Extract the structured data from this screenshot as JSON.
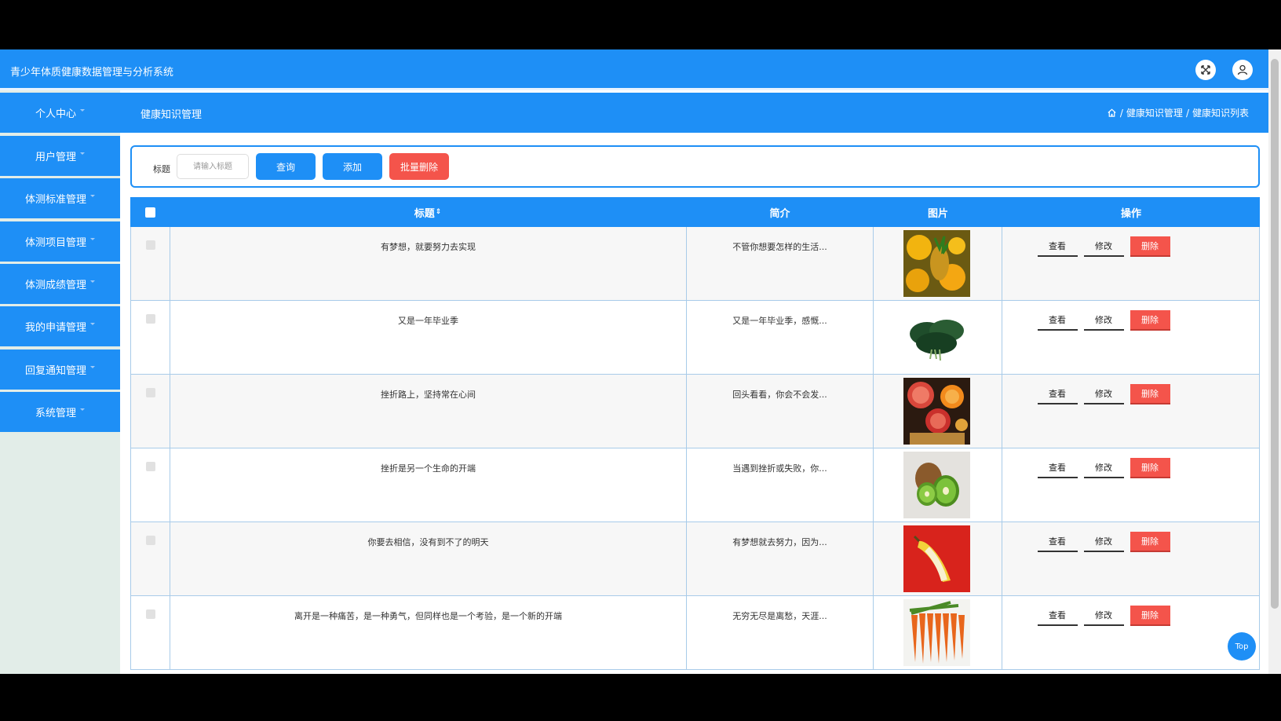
{
  "header": {
    "title": "青少年体质健康数据管理与分析系统"
  },
  "sidebar": {
    "items": [
      {
        "label": "个人中心"
      },
      {
        "label": "用户管理"
      },
      {
        "label": "体测标准管理"
      },
      {
        "label": "体测项目管理"
      },
      {
        "label": "体测成绩管理"
      },
      {
        "label": "我的申请管理"
      },
      {
        "label": "回复通知管理"
      },
      {
        "label": "系统管理"
      }
    ]
  },
  "subheader": {
    "title": "健康知识管理",
    "breadcrumb": [
      "健康知识管理",
      "健康知识列表"
    ],
    "separator": "/"
  },
  "search": {
    "label": "标题",
    "placeholder": "请输入标题",
    "query_label": "查询",
    "add_label": "添加",
    "batch_delete_label": "批量删除"
  },
  "table": {
    "columns": {
      "title": "标题",
      "intro": "简介",
      "image": "图片",
      "actions": "操作"
    },
    "actions": {
      "view": "查看",
      "edit": "修改",
      "delete": "删除"
    },
    "rows": [
      {
        "title": "有梦想，就要努力去实现",
        "intro": "不管你想要怎样的生活...",
        "image": "fruit-pineapple-orange"
      },
      {
        "title": "又是一年毕业季",
        "intro": "又是一年毕业季，感慨...",
        "image": "vegetable-spinach"
      },
      {
        "title": "挫折路上，坚持常在心间",
        "intro": "回头看看，你会不会发...",
        "image": "fruit-grapefruit-mix"
      },
      {
        "title": "挫折是另一个生命的开端",
        "intro": "当遇到挫折或失败，你...",
        "image": "fruit-kiwi"
      },
      {
        "title": "你要去相信，没有到不了的明天",
        "intro": "有梦想就去努力，因为...",
        "image": "fruit-banana"
      },
      {
        "title": "离开是一种痛苦，是一种勇气，但同样也是一个考验，是一个新的开端",
        "intro": "无穷无尽是离愁，天涯...",
        "image": "vegetable-carrots"
      }
    ]
  },
  "top_button": "Top",
  "colors": {
    "primary": "#1e8ff6",
    "danger": "#f4544b",
    "sidebar_bg": "#e2ede8"
  }
}
